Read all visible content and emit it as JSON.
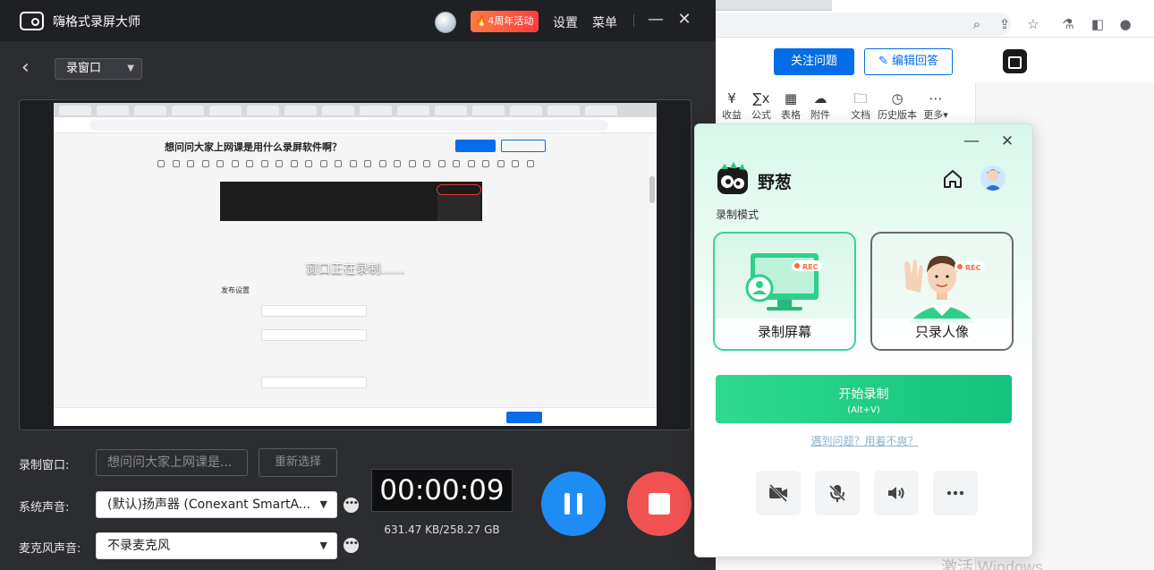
{
  "recorder": {
    "app_name": "嗨格式录屏大师",
    "promo_label": "4周年活动",
    "settings_label": "设置",
    "menu_label": "菜单",
    "minimize_glyph": "—",
    "close_glyph": "✕",
    "mode_selected": "录窗口",
    "preview": {
      "recording_message": "窗口正在录制......",
      "captured_question": "想问问大家上网课是用什么录屏软件啊？",
      "captured_form_title": "发布设置"
    },
    "window_row": {
      "label": "录制窗口:",
      "placeholder": "想问问大家上网课是...",
      "reselect_label": "重新选择"
    },
    "system_audio_row": {
      "label": "系统声音:",
      "value": "(默认)扬声器 (Conexant SmartA..."
    },
    "mic_row": {
      "label": "麦克风声音:",
      "value": "不录麦克风"
    },
    "timer": "00:00:09",
    "size_info": "631.47 KB/258.27 GB",
    "colors": {
      "pause": "#1e8cf5",
      "stop": "#f25252",
      "background": "#2c2d31"
    }
  },
  "background_browser": {
    "follow_button": "关注问题",
    "edit_answer_button": "编辑回答",
    "toolbar": [
      {
        "icon": "revenue-icon",
        "glyph": "¥",
        "label": "收益"
      },
      {
        "icon": "formula-icon",
        "glyph": "∑x",
        "label": "公式"
      },
      {
        "icon": "table-icon",
        "glyph": "▦",
        "label": "表格"
      },
      {
        "icon": "attachment-icon",
        "glyph": "☁",
        "label": "附件"
      },
      {
        "icon": "document-icon",
        "glyph": "🗀",
        "label": "文档"
      },
      {
        "icon": "history-icon",
        "glyph": "◷",
        "label": "历史版本"
      },
      {
        "icon": "more-icon",
        "glyph": "⋯",
        "label": "更多▾"
      }
    ],
    "watermark": "激活 Windows"
  },
  "popup": {
    "brand": "野葱",
    "mode_label": "录制模式",
    "modes": [
      {
        "label": "录制屏幕",
        "badge": "REC",
        "selected": true
      },
      {
        "label": "只录人像",
        "badge": "REC",
        "selected": false
      }
    ],
    "start_button": "开始录制",
    "start_shortcut": "(Alt+V)",
    "help_link": "遇到问题？用着不爽？",
    "accent": "#1fcc84"
  }
}
